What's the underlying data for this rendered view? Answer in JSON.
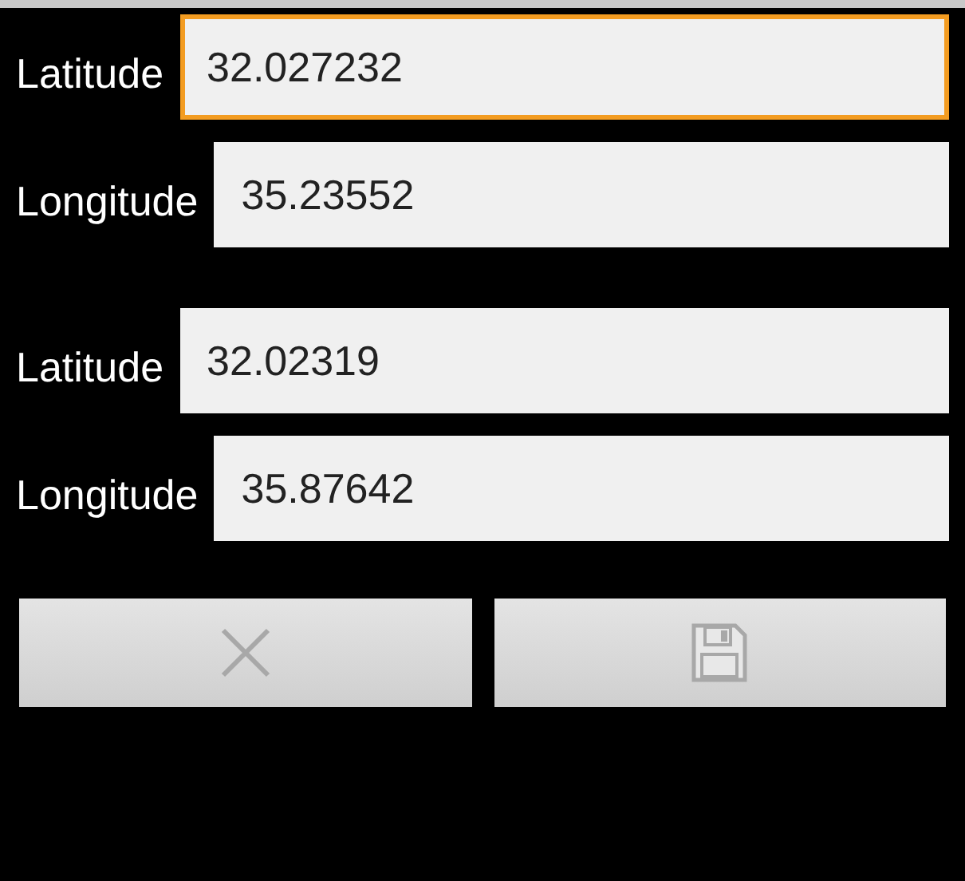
{
  "groups": [
    {
      "fields": [
        {
          "label": "Latitude",
          "value": "32.027232",
          "focused": true
        },
        {
          "label": "Longitude",
          "value": "35.23552",
          "focused": false
        }
      ]
    },
    {
      "fields": [
        {
          "label": "Latitude",
          "value": "32.02319",
          "focused": false
        },
        {
          "label": "Longitude",
          "value": "35.87642",
          "focused": false
        }
      ]
    }
  ],
  "buttons": [
    {
      "kind": "cancel",
      "disabled": true
    },
    {
      "kind": "save",
      "disabled": true
    }
  ]
}
